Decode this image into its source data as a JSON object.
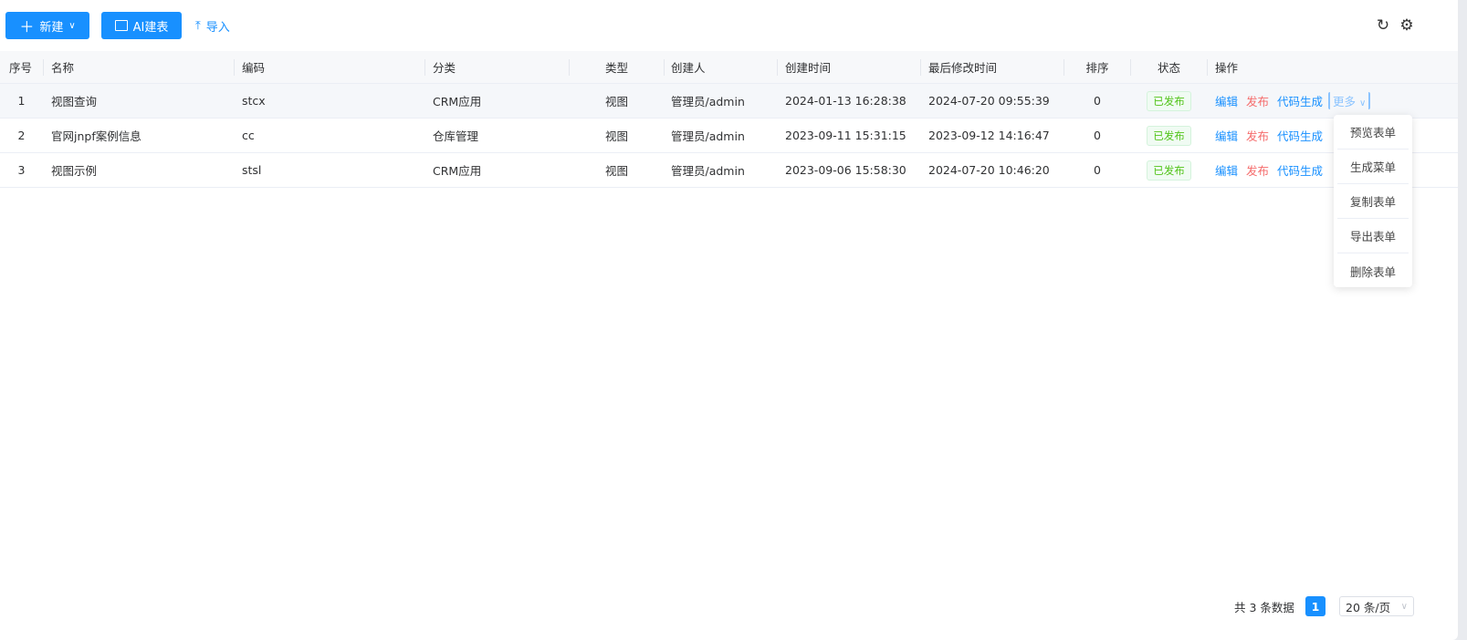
{
  "toolbar": {
    "new_label": "新建",
    "ai_label": "AI建表",
    "import_label": "导入"
  },
  "table": {
    "headers": [
      "序号",
      "名称",
      "编码",
      "分类",
      "类型",
      "创建人",
      "创建时间",
      "最后修改时间",
      "排序",
      "状态",
      "操作"
    ],
    "rows": [
      {
        "index": "1",
        "name": "视图查询",
        "code": "stcx",
        "category": "CRM应用",
        "type": "视图",
        "creator": "管理员/admin",
        "created": "2024-01-13 16:28:38",
        "modified": "2024-07-20 09:55:39",
        "sort": "0",
        "status": "已发布"
      },
      {
        "index": "2",
        "name": "官网jnpf案例信息",
        "code": "cc",
        "category": "仓库管理",
        "type": "视图",
        "creator": "管理员/admin",
        "created": "2023-09-11 15:31:15",
        "modified": "2023-09-12 14:16:47",
        "sort": "0",
        "status": "已发布"
      },
      {
        "index": "3",
        "name": "视图示例",
        "code": "stsl",
        "category": "CRM应用",
        "type": "视图",
        "creator": "管理员/admin",
        "created": "2023-09-06 15:58:30",
        "modified": "2024-07-20 10:46:20",
        "sort": "0",
        "status": "已发布"
      }
    ],
    "actions": {
      "edit": "编辑",
      "publish": "发布",
      "codegen": "代码生成",
      "more": "更多"
    }
  },
  "more_menu": [
    "预览表单",
    "生成菜单",
    "复制表单",
    "导出表单",
    "删除表单"
  ],
  "pagination": {
    "total_text": "共 3 条数据",
    "current_page": "1",
    "page_size": "20 条/页"
  },
  "colors": {
    "primary": "#1890ff",
    "danger": "#f56c6c",
    "success": "#52c41a"
  }
}
